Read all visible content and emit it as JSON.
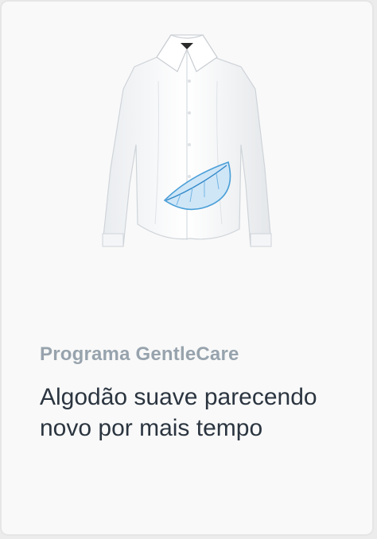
{
  "card": {
    "subtitle": "Programa GentleCare",
    "headline": "Algodão suave parecendo novo por mais tempo"
  },
  "image": {
    "subject": "white-shirt-with-blue-feather",
    "feather_color": "#4a9fd8",
    "shirt_color": "#ffffff"
  }
}
